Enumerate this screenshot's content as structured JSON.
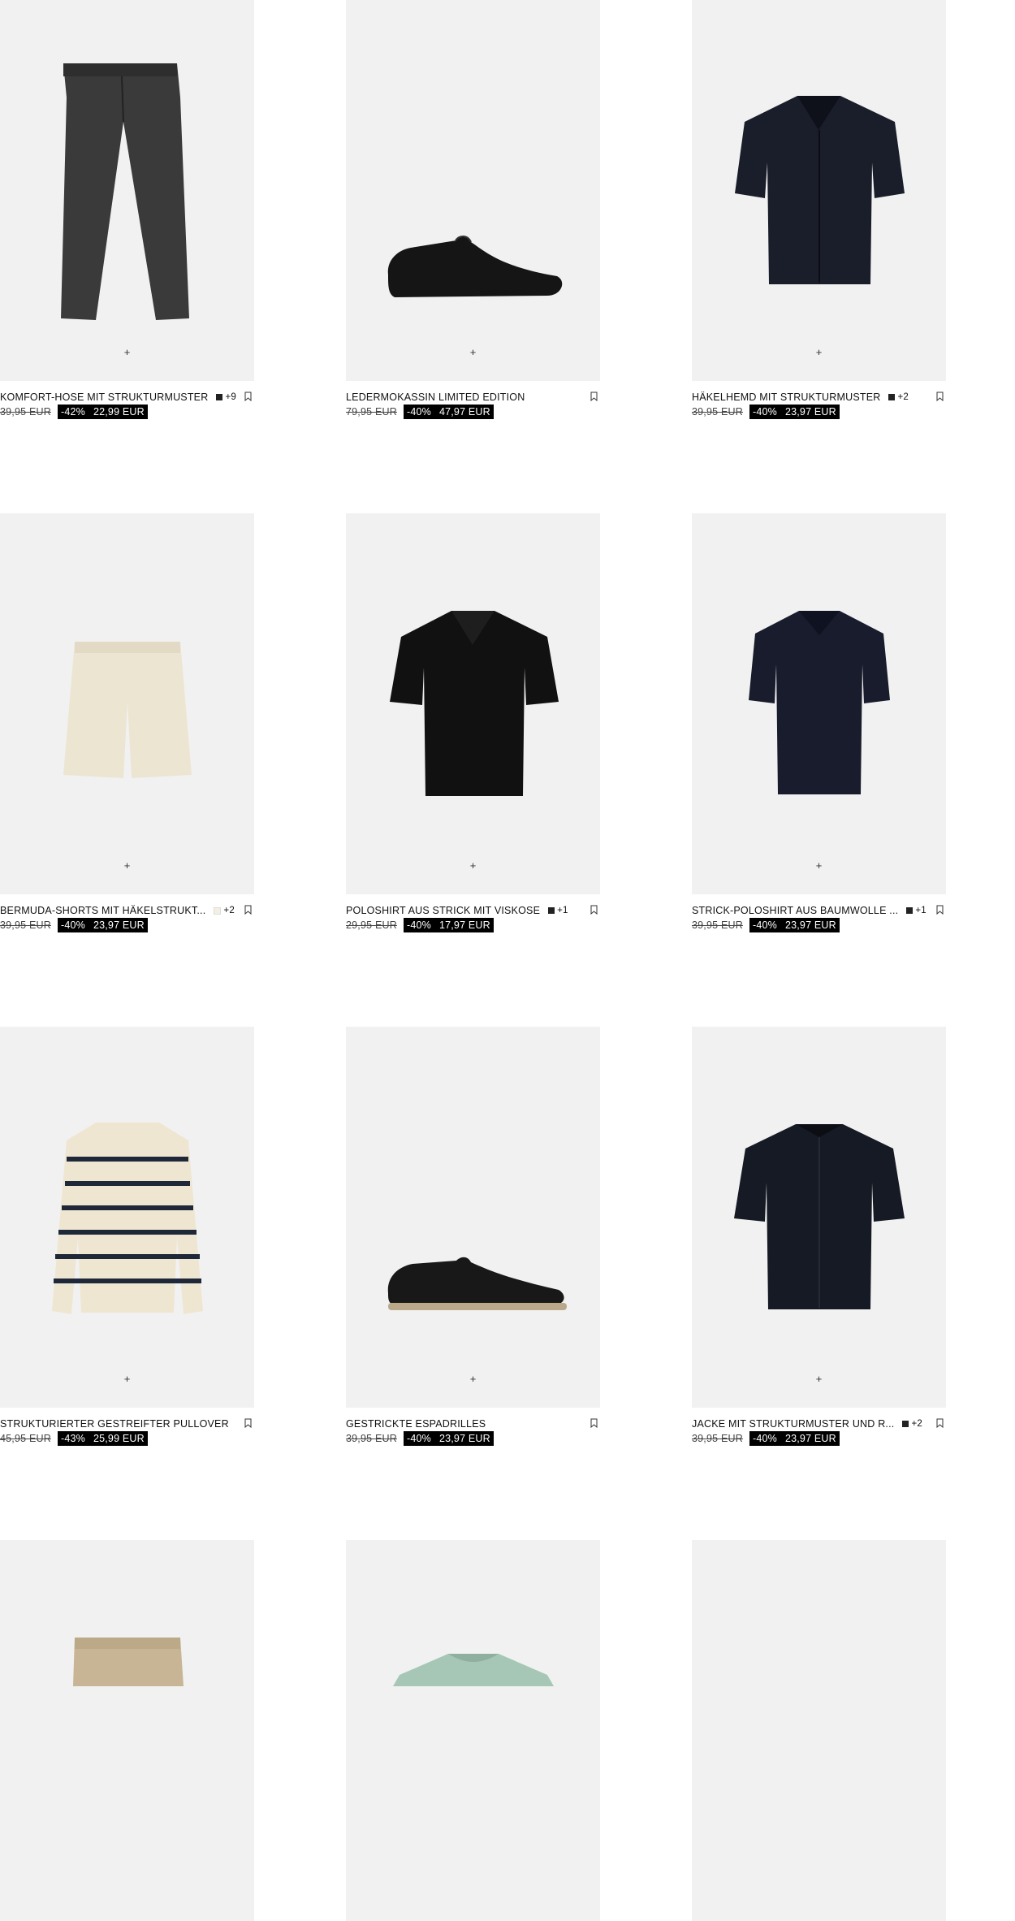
{
  "products": [
    {
      "name": "KOMFORT-HOSE MIT STRUKTURMUSTER",
      "swatch": "#222222",
      "colors_more": "+9",
      "old_price": "39,95 EUR",
      "discount": "-42%",
      "price": "22,99 EUR",
      "icon": "trousers"
    },
    {
      "name": "LEDERMOKASSIN LIMITED EDITION",
      "swatch": "",
      "colors_more": "",
      "old_price": "79,95 EUR",
      "discount": "-40%",
      "price": "47,97 EUR",
      "icon": "loafer"
    },
    {
      "name": "HÄKELHEMD MIT STRUKTURMUSTER",
      "swatch": "#222222",
      "colors_more": "+2",
      "old_price": "39,95 EUR",
      "discount": "-40%",
      "price": "23,97 EUR",
      "icon": "shirt"
    },
    {
      "name": "BERMUDA-SHORTS MIT HÄKELSTRUKT...",
      "swatch": "#f3efe2",
      "colors_more": "+2",
      "old_price": "39,95 EUR",
      "discount": "-40%",
      "price": "23,97 EUR",
      "icon": "shorts"
    },
    {
      "name": "POLOSHIRT AUS STRICK MIT VISKOSE",
      "swatch": "#222222",
      "colors_more": "+1",
      "old_price": "29,95 EUR",
      "discount": "-40%",
      "price": "17,97 EUR",
      "icon": "polo"
    },
    {
      "name": "STRICK-POLOSHIRT AUS BAUMWOLLE ...",
      "swatch": "#222222",
      "colors_more": "+1",
      "old_price": "39,95 EUR",
      "discount": "-40%",
      "price": "23,97 EUR",
      "icon": "polo-knit"
    },
    {
      "name": "STRUKTURIERTER GESTREIFTER PULLOVER",
      "swatch": "",
      "colors_more": "",
      "old_price": "45,95 EUR",
      "discount": "-43%",
      "price": "25,99 EUR",
      "icon": "sweater"
    },
    {
      "name": "GESTRICKTE ESPADRILLES",
      "swatch": "",
      "colors_more": "",
      "old_price": "39,95 EUR",
      "discount": "-40%",
      "price": "23,97 EUR",
      "icon": "espadrille"
    },
    {
      "name": "JACKE MIT STRUKTURMUSTER UND R...",
      "swatch": "#222222",
      "colors_more": "+2",
      "old_price": "39,95 EUR",
      "discount": "-40%",
      "price": "23,97 EUR",
      "icon": "zip-polo"
    },
    {
      "name": "",
      "swatch": "",
      "colors_more": "",
      "old_price": "",
      "discount": "",
      "price": "",
      "icon": "chino-shorts"
    },
    {
      "name": "",
      "swatch": "",
      "colors_more": "",
      "old_price": "",
      "discount": "",
      "price": "",
      "icon": "tshirt"
    },
    {
      "name": "",
      "swatch": "",
      "colors_more": "",
      "old_price": "",
      "discount": "",
      "price": "",
      "icon": "empty"
    }
  ],
  "add_icon": "plus-icon",
  "bookmark_icon": "bookmark-icon"
}
